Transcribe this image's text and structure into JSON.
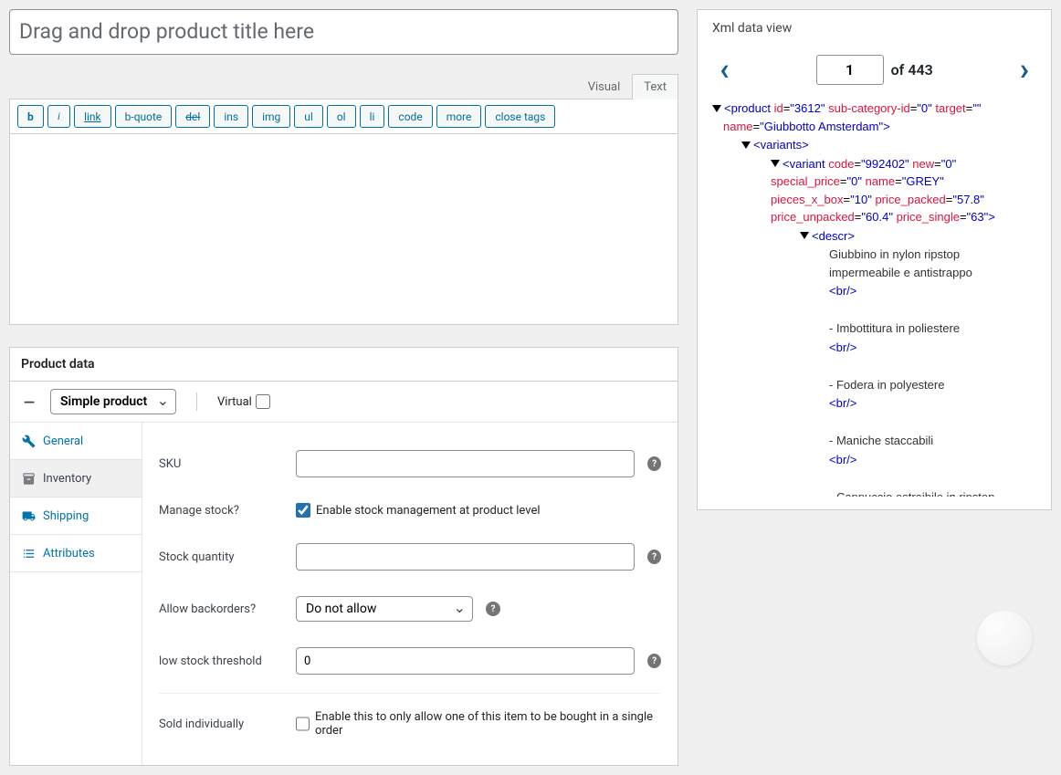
{
  "title_input": {
    "placeholder": "Drag and drop product title here",
    "value": ""
  },
  "editor_tabs": {
    "visual": "Visual",
    "text": "Text"
  },
  "toolbar": {
    "b": "b",
    "i": "i",
    "link": "link",
    "bquote": "b-quote",
    "del": "del",
    "ins": "ins",
    "img": "img",
    "ul": "ul",
    "ol": "ol",
    "li": "li",
    "code": "code",
    "more": "more",
    "close": "close tags"
  },
  "product_data": {
    "heading": "Product data",
    "type_options": [
      "Simple product"
    ],
    "type_selected": "Simple product",
    "virtual_label": "Virtual",
    "virtual_checked": false,
    "tabs": {
      "general": "General",
      "inventory": "Inventory",
      "shipping": "Shipping",
      "attributes": "Attributes"
    },
    "fields": {
      "sku_label": "SKU",
      "sku_value": "",
      "manage_stock_label": "Manage stock?",
      "manage_stock_cb_label": "Enable stock management at product level",
      "manage_stock_checked": true,
      "stock_qty_label": "Stock quantity",
      "stock_qty_value": "",
      "backorders_label": "Allow backorders?",
      "backorders_selected": "Do not allow",
      "backorders_options": [
        "Do not allow"
      ],
      "low_stock_label": "low stock threshold",
      "low_stock_value": "0",
      "sold_individually_label": "Sold individually",
      "sold_individually_cb_label": "Enable this to only allow one of this item to be bought in a single order",
      "sold_individually_checked": false
    }
  },
  "xml_view": {
    "title": "Xml data view",
    "page_current": "1",
    "page_total": "of 443",
    "nodes": {
      "product_open1": "<product ",
      "product_attrs": [
        {
          "k": "id",
          "v": "3612"
        },
        {
          "k": "sub-category-id",
          "v": "0"
        },
        {
          "k": "target",
          "v": ""
        },
        {
          "k": "name",
          "v": "Giubbotto Amsterdam"
        }
      ],
      "variants_open": "<variants>",
      "variant_open": "<variant ",
      "variant_attrs": [
        {
          "k": "code",
          "v": "992402"
        },
        {
          "k": "new",
          "v": "0"
        },
        {
          "k": "special_price",
          "v": "0"
        },
        {
          "k": "name",
          "v": "GREY"
        },
        {
          "k": "pieces_x_box",
          "v": "10"
        },
        {
          "k": "price_packed",
          "v": "57.8"
        },
        {
          "k": "price_unpacked",
          "v": "60.4"
        },
        {
          "k": "price_single",
          "v": "63"
        }
      ],
      "descr_open": "<descr>",
      "descr_text1": "Giubbino in nylon ripstop impermeabile e antistrappo",
      "br": "<br/>",
      "descr_text2": "- Imbottitura in poliestere",
      "descr_text3": "- Fodera in polyestere",
      "descr_text4": "- Maniche staccabili",
      "descr_text5": "- Cappuccio estraibile in ripstop"
    }
  }
}
